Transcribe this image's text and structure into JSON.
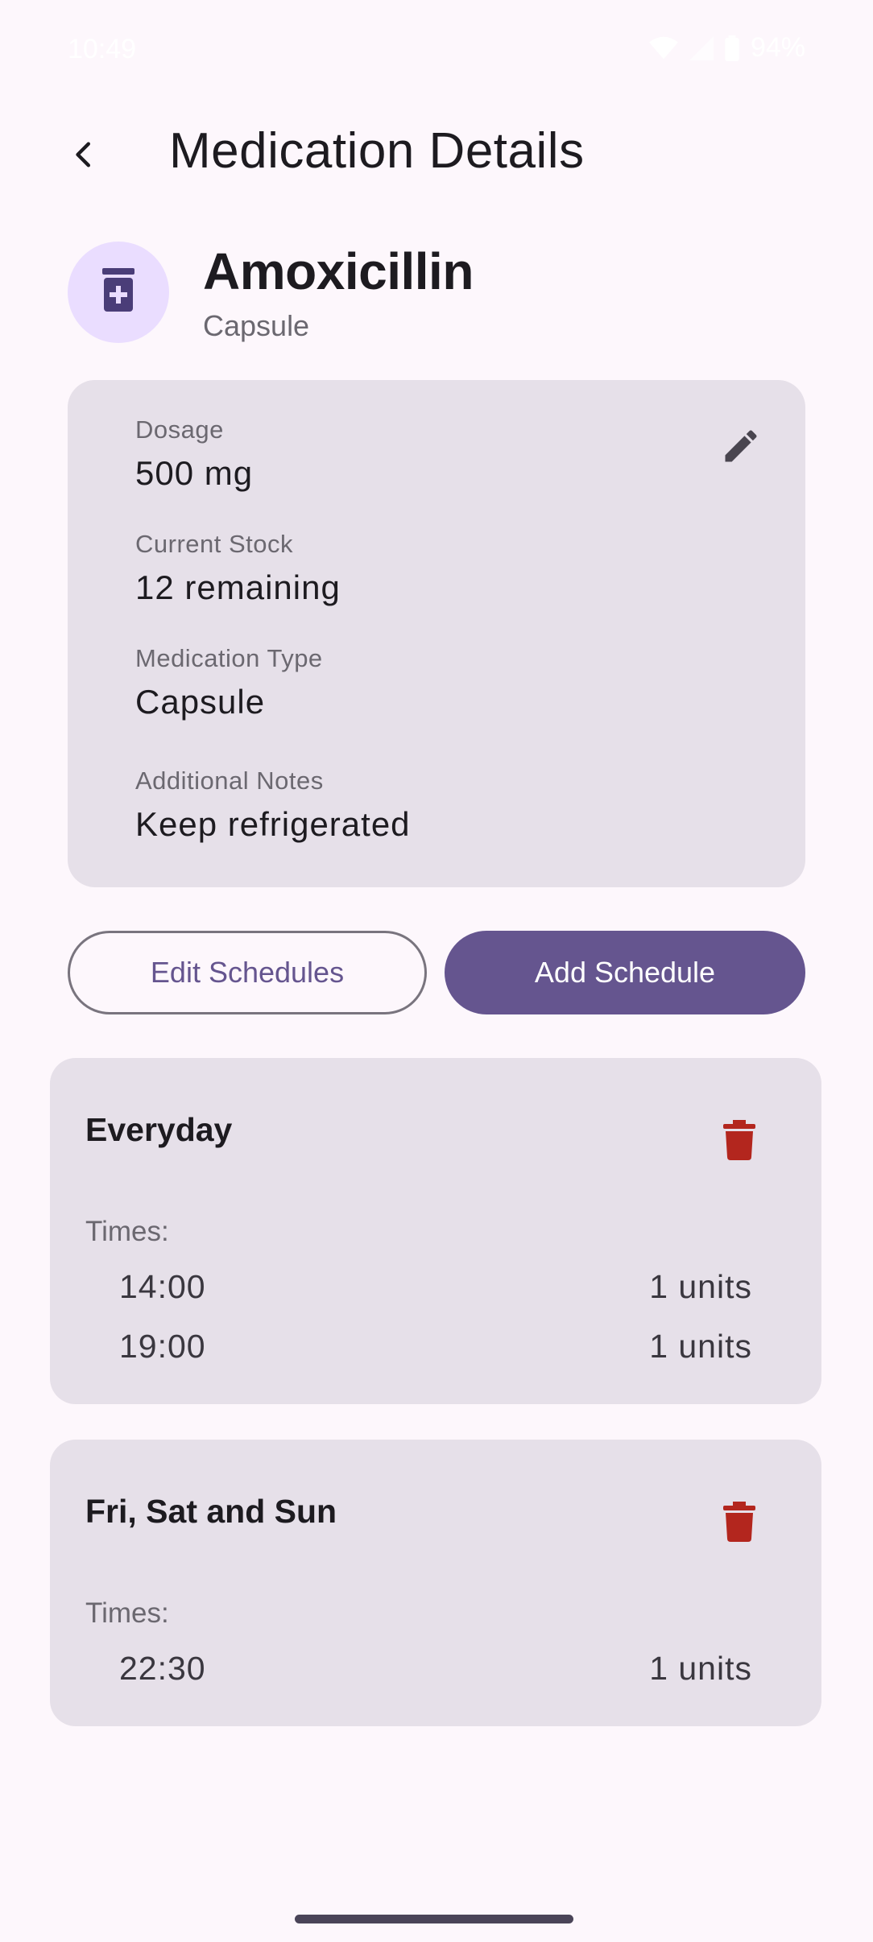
{
  "status_bar": {
    "time": "10:49",
    "battery": "94%"
  },
  "header": {
    "title": "Medication Details",
    "back_icon": "arrow-back-icon"
  },
  "medication": {
    "name": "Amoxicillin",
    "type": "Capsule",
    "icon": "medication-bottle-icon"
  },
  "details": {
    "dosage_label": "Dosage",
    "dosage_value": "500 mg",
    "stock_label": "Current Stock",
    "stock_value": "12 remaining",
    "type_label": "Medication Type",
    "type_value": "Capsule",
    "notes_label": "Additional Notes",
    "notes_value": "Keep refrigerated",
    "edit_icon": "edit-pencil-icon"
  },
  "actions": {
    "edit_schedules": "Edit Schedules",
    "add_schedule": "Add Schedule"
  },
  "schedules": [
    {
      "title": "Everyday",
      "times_label": "Times:",
      "times": [
        {
          "time": "14:00",
          "amount": "1 units"
        },
        {
          "time": "19:00",
          "amount": "1 units"
        }
      ]
    },
    {
      "title": "Fri, Sat and Sun",
      "times_label": "Times:",
      "times": [
        {
          "time": "22:30",
          "amount": "1 units"
        }
      ]
    }
  ],
  "colors": {
    "background": "#fdf7fc",
    "card": "#e6e0e9",
    "primary": "#65558f",
    "avatar_bg": "#eaddff",
    "delete": "#b3261e"
  }
}
